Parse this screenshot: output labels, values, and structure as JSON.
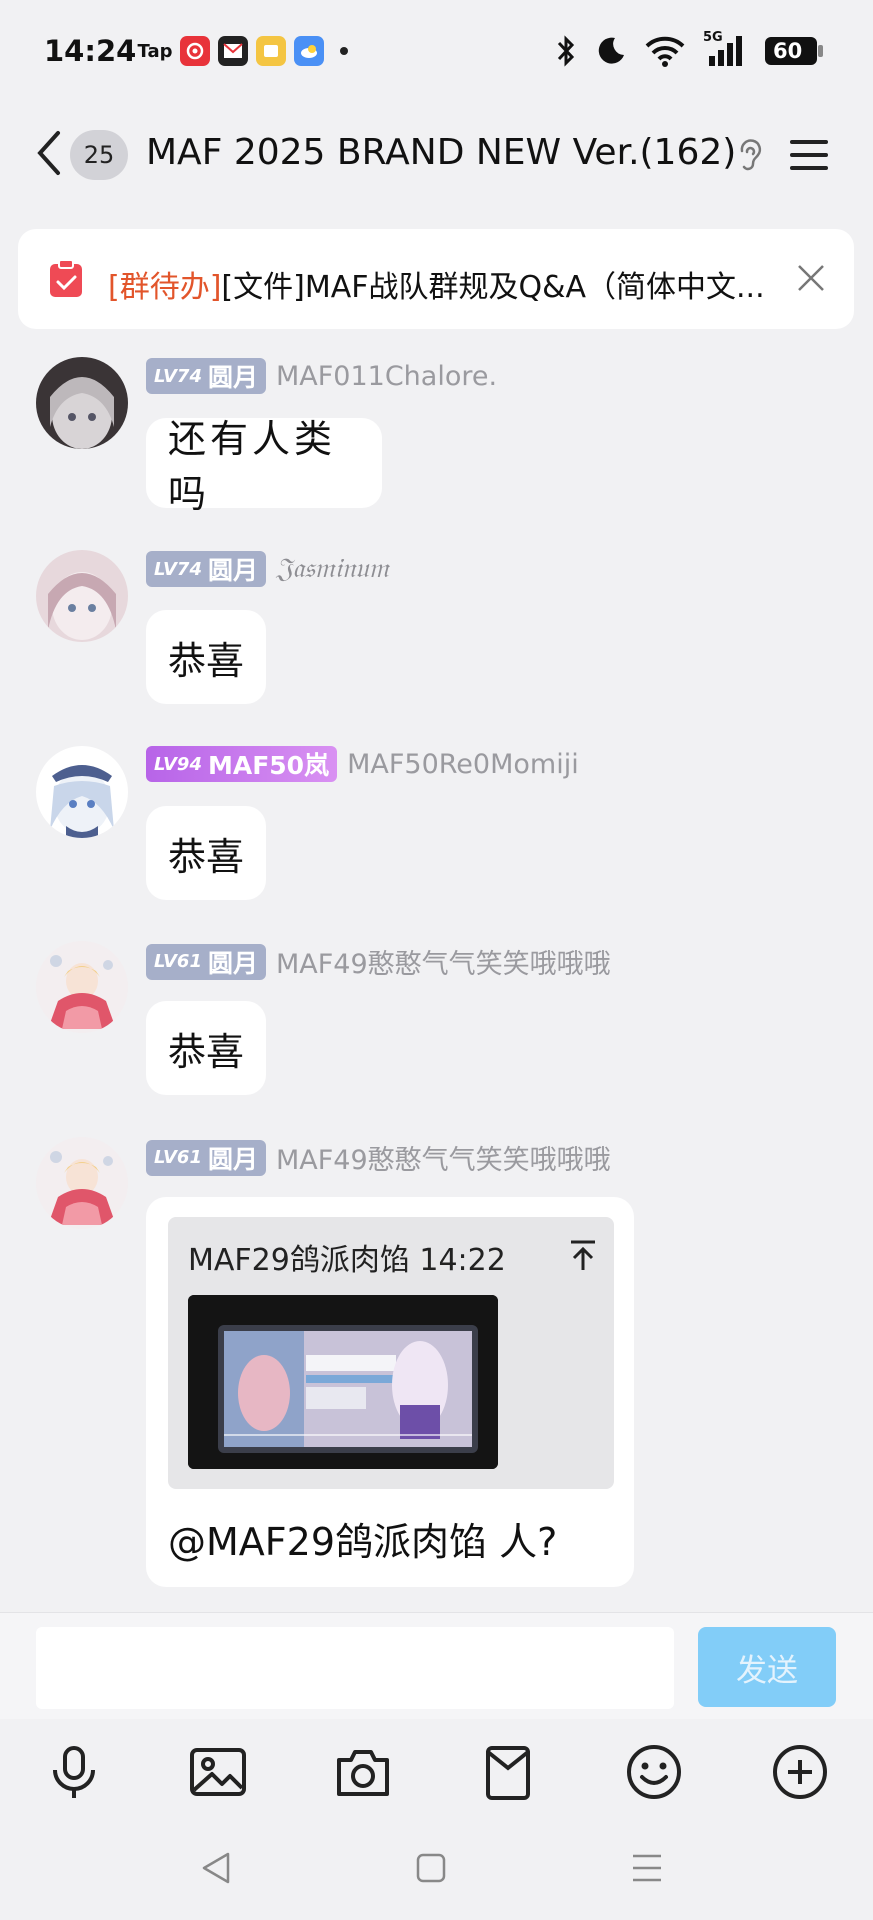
{
  "status_bar": {
    "time": "14:24",
    "app_icons": [
      "taptap-icon",
      "netease-music-icon",
      "mail-app-icon",
      "notes-app-icon",
      "weather-app-icon"
    ],
    "taptap_label": "Tap",
    "battery": "60",
    "signal": "5G"
  },
  "header": {
    "unread_count": "25",
    "title": "MAF 2025 BRAND NEW Ver.(162)"
  },
  "notice": {
    "tag": "[群待办]",
    "text": "[文件]MAF战队群规及Q&A（简体中文..."
  },
  "messages": [
    {
      "level": "LV74",
      "title": "圆月",
      "nickname": "MAF011Chalore.",
      "text": "还有人类吗"
    },
    {
      "level": "LV74",
      "title": "圆月",
      "nickname": "𝔍𝔞𝔰𝔪𝔦𝔫𝔲𝔪",
      "text": "恭喜"
    },
    {
      "level": "LV94",
      "title": "MAF50岚",
      "nickname": "MAF50Re0Momiji",
      "text": "恭喜"
    },
    {
      "level": "LV61",
      "title": "圆月",
      "nickname": "MAF49憨憨气气笑笑哦哦哦",
      "text": "恭喜"
    },
    {
      "level": "LV61",
      "title": "圆月",
      "nickname": "MAF49憨憨气气笑笑哦哦哦",
      "text": "@MAF29鸽派肉馅 人?"
    }
  ],
  "quote": {
    "author_time": "MAF29鸽派肉馅 14:22"
  },
  "input": {
    "value": "",
    "send_label": "发送"
  },
  "toolbar": [
    "microphone-icon",
    "image-icon",
    "camera-icon",
    "red-packet-icon",
    "emoji-icon",
    "plus-icon"
  ],
  "colors": {
    "background": "#f1f1f3",
    "notice_tag": "#e2552b",
    "send_button": "#82cdf8",
    "level_badge": "#a6afc9",
    "level_badge_purple": "#b764e8"
  }
}
